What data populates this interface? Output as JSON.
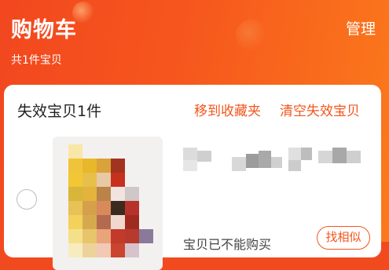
{
  "header": {
    "title": "购物车",
    "manage_label": "管理",
    "count_text": "共1件宝贝"
  },
  "invalid_section": {
    "title": "失效宝贝1件",
    "move_to_favorites": "移到收藏夹",
    "clear_invalid": "清空失效宝贝"
  },
  "item": {
    "status_text": "宝贝已不能购买",
    "similar_button": "找相似"
  },
  "colors": {
    "accent": "#f2561d",
    "header_start": "#f2471f",
    "header_end": "#fb7a1c"
  }
}
